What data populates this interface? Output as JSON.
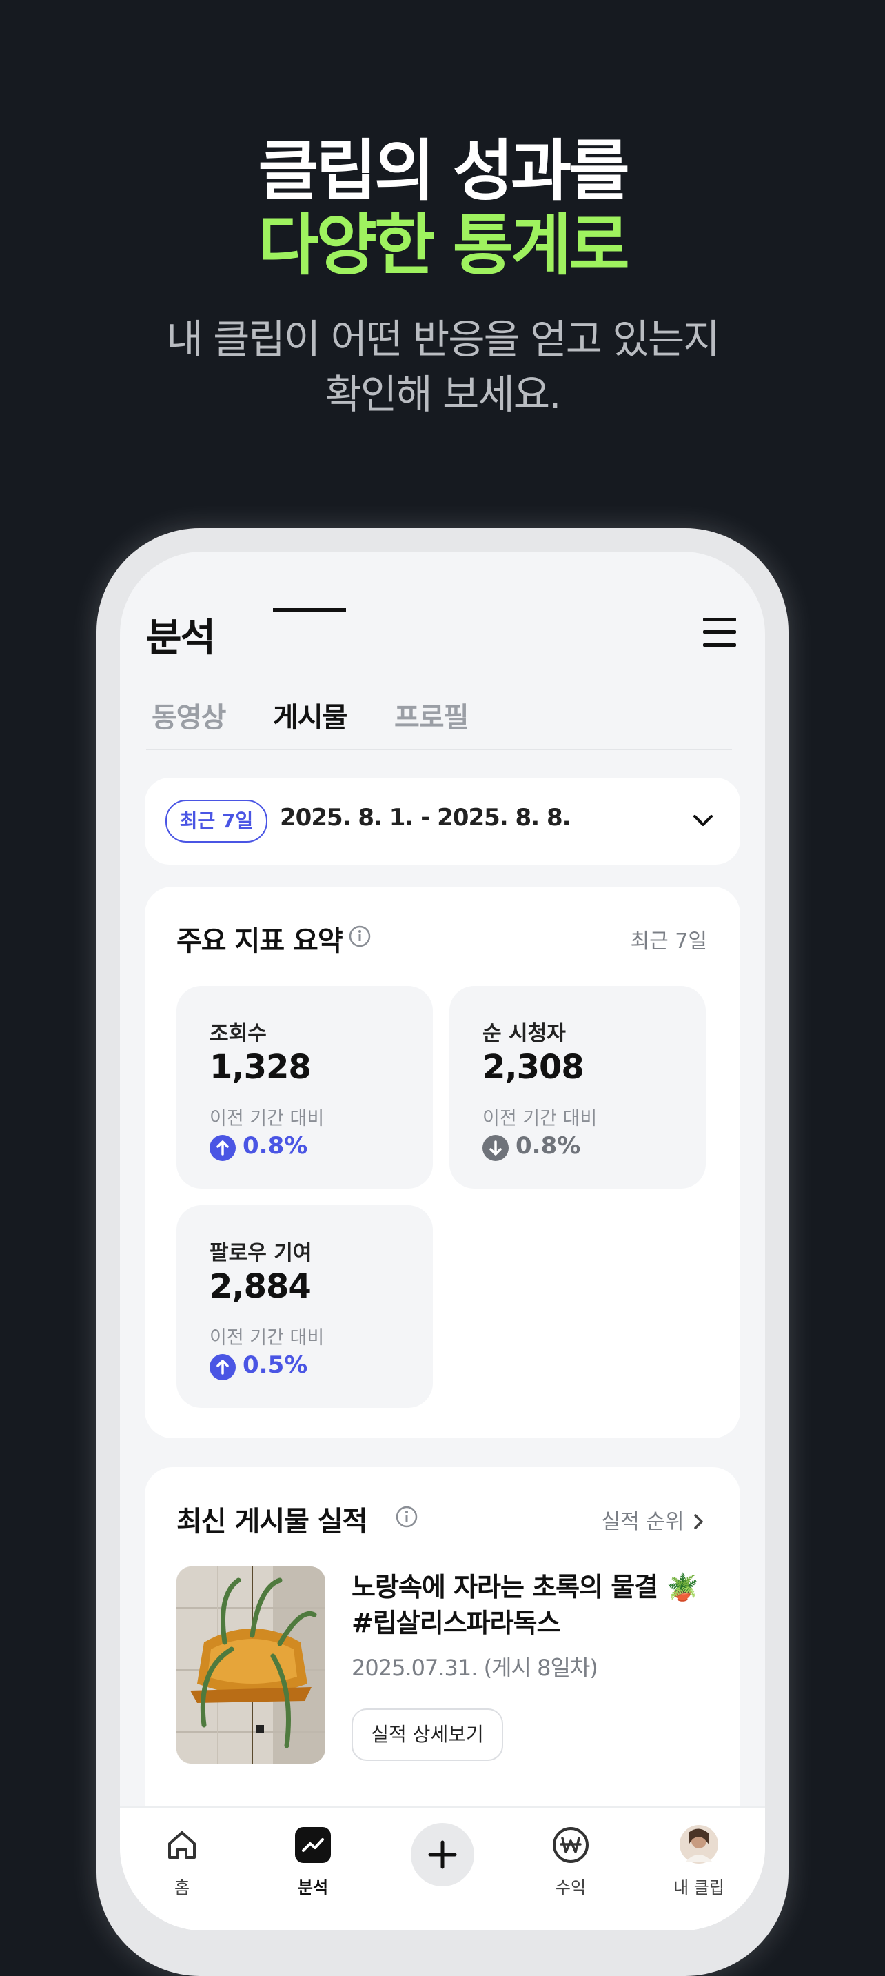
{
  "hero": {
    "line1": "클립의 성과를",
    "line2": "다양한 통계로",
    "sub1": "내 클립이 어떤 반응을 얻고 있는지",
    "sub2": "확인해 보세요."
  },
  "app": {
    "title": "분석",
    "tabs": [
      {
        "label": "동영상",
        "active": false
      },
      {
        "label": "게시물",
        "active": true
      },
      {
        "label": "프로필",
        "active": false
      }
    ]
  },
  "date_filter": {
    "pill": "최근 7일",
    "range": "2025. 8. 1. - 2025. 8. 8."
  },
  "summary": {
    "title": "주요 지표 요약",
    "period": "최근 7일",
    "metrics": [
      {
        "label": "조회수",
        "value": "1,328",
        "compare": "이전 기간 대비",
        "change": "0.8%",
        "direction": "up"
      },
      {
        "label": "순 시청자",
        "value": "2,308",
        "compare": "이전 기간 대비",
        "change": "0.8%",
        "direction": "down"
      },
      {
        "label": "팔로우 기여",
        "value": "2,884",
        "compare": "이전 기간 대비",
        "change": "0.5%",
        "direction": "up"
      }
    ]
  },
  "posts": {
    "title": "최신 게시물 실적",
    "link": "실적 순위",
    "item": {
      "title": "노랑속에 자라는 초록의 물결 🪴 #립살리스파라독스",
      "date": "2025.07.31. (게시 8일차)",
      "button": "실적 상세보기"
    }
  },
  "nav": {
    "home": "홈",
    "analytics": "분석",
    "earnings": "수익",
    "my_clip": "내 클립"
  },
  "colors": {
    "accent": "#4a55e4",
    "hero_green": "#9ff25f",
    "background": "#161a20"
  }
}
